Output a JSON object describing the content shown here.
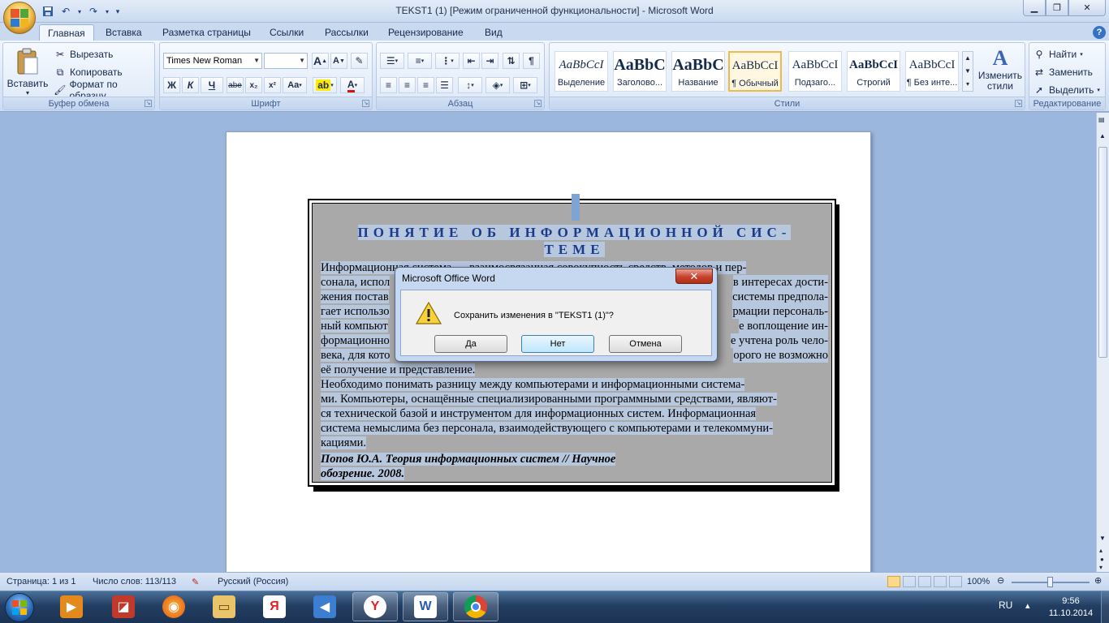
{
  "window": {
    "title": "TEKST1 (1) [Режим ограниченной функциональности] - Microsoft Word",
    "controls": [
      "minimize-icon",
      "restore-icon",
      "close-icon"
    ]
  },
  "tabs": [
    "Главная",
    "Вставка",
    "Разметка страницы",
    "Ссылки",
    "Рассылки",
    "Рецензирование",
    "Вид"
  ],
  "ribbon": {
    "clipboard": {
      "paste": "Вставить",
      "cut": "Вырезать",
      "copy": "Копировать",
      "format_painter": "Формат по образцу",
      "label": "Буфер обмена"
    },
    "font": {
      "name": "Times New Roman",
      "size": "",
      "bold": "Ж",
      "italic": "К",
      "underline": "Ч",
      "strike": "abe",
      "subscript": "x₂",
      "superscript": "x²",
      "case": "Aa",
      "grow": "A",
      "shrink": "A",
      "label": "Шрифт"
    },
    "paragraph": {
      "label": "Абзац"
    },
    "styles": {
      "items": [
        {
          "sample": "AaBbCcI",
          "name": "Выделение"
        },
        {
          "sample": "AaBbC",
          "name": "Заголово..."
        },
        {
          "sample": "AaBbC",
          "name": "Название"
        },
        {
          "sample": "AaBbCcI",
          "name": "¶ Обычный"
        },
        {
          "sample": "AaBbCcI",
          "name": "Подзаго..."
        },
        {
          "sample": "AaBbCcI",
          "name": "Строгий"
        },
        {
          "sample": "AaBbCcI",
          "name": "¶ Без инте..."
        }
      ],
      "change": "Изменить стили",
      "label": "Стили"
    },
    "editing": {
      "find": "Найти",
      "replace": "Заменить",
      "select": "Выделить",
      "label": "Редактирование"
    }
  },
  "document": {
    "heading_line1": "ПОНЯТИЕ ОБ ИНФОРМАЦИОННОЙ СИС-",
    "heading_line2": "ТЕМЕ",
    "lines": [
      "        Информационная система — взаимосвязанная совокупность средств, методов и пер-",
      "сонала, испол",
      "жения постав",
      "гает использо",
      "ный компьют",
      "формационно",
      "века, для кото",
      "её получение и представление."
    ],
    "lines_right": [
      "",
      "в интересах дости-",
      "системы предпола-",
      "рмации персональ-",
      "е воплощение ин-",
      "е учтена роль чело-",
      "орого не возможно",
      ""
    ],
    "para2": [
      "        Необходимо понимать разницу между компьютерами и информационными система-",
      "ми. Компьютеры, оснащённые специализированными программными средствами, являют-",
      "ся технической базой и инструментом для информационных систем. Информационная",
      "система немыслима без персонала, взаимодействующего с компьютерами и телекоммуни-",
      "кациями."
    ],
    "citation1": "        Попов Ю.А. Теория информационных систем // Научное",
    "citation2": "обозрение. 2008."
  },
  "dialog": {
    "title": "Microsoft Office Word",
    "message": "Сохранить изменения в \"TEKST1 (1)\"?",
    "yes": "Да",
    "no": "Нет",
    "cancel": "Отмена"
  },
  "status": {
    "page": "Страница: 1 из 1",
    "words": "Число слов: 113/113",
    "language": "Русский (Россия)",
    "zoom": "100%"
  },
  "taskbar": {
    "apps": [
      "media-player-icon",
      "presentation-icon",
      "firefox-icon",
      "explorer-icon",
      "yandex-icon",
      "volume-app-icon",
      "yandex-browser-icon",
      "word-icon",
      "chrome-icon"
    ],
    "lang": "RU",
    "time": "9:56",
    "date": "11.10.2014"
  }
}
